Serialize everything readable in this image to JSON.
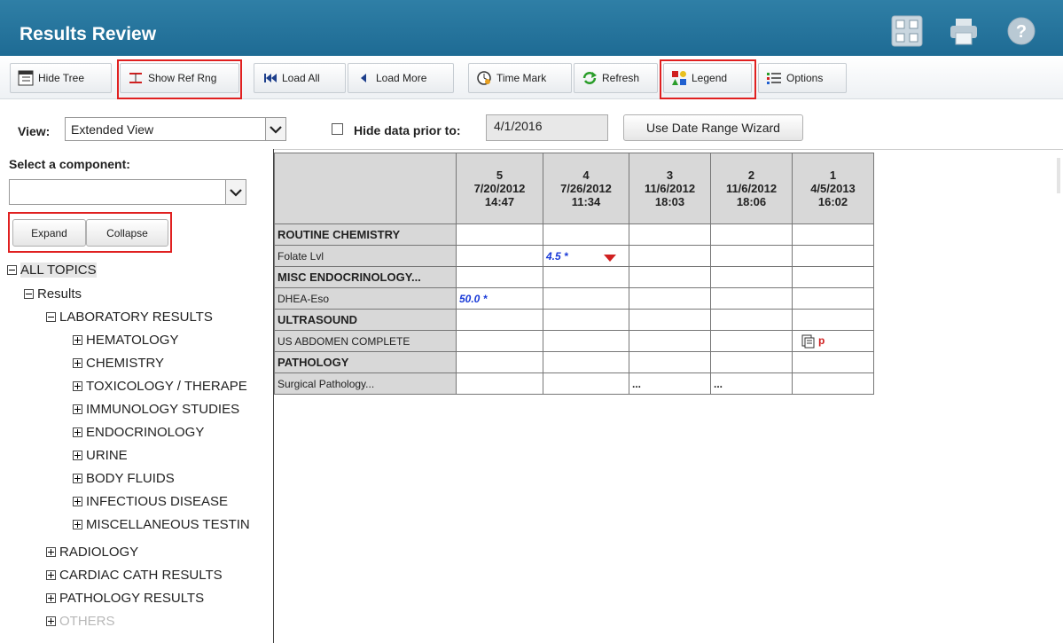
{
  "header": {
    "title": "Results Review",
    "icons": [
      "expand-icon",
      "print-icon",
      "help-icon"
    ]
  },
  "toolbar": {
    "hide_tree": "Hide Tree",
    "show_ref_rng": "Show Ref Rng",
    "load_all": "Load All",
    "load_more": "Load More",
    "time_mark": "Time Mark",
    "refresh": "Refresh",
    "legend": "Legend",
    "options": "Options"
  },
  "view": {
    "label": "View:",
    "selected": "Extended View",
    "hide_prior_label": "Hide data prior to:",
    "hide_prior_date": "4/1/2016",
    "date_wizard": "Use Date Range Wizard"
  },
  "left": {
    "select_label": "Select a component:",
    "select_value": "",
    "expand": "Expand",
    "collapse": "Collapse",
    "tree": [
      {
        "label": "ALL TOPICS",
        "level": 0,
        "expanded": true
      },
      {
        "label": "Results",
        "level": 1,
        "expanded": true
      },
      {
        "label": "LABORATORY RESULTS",
        "level": 2,
        "expanded": true
      },
      {
        "label": "HEMATOLOGY",
        "level": 3,
        "expanded": false
      },
      {
        "label": "CHEMISTRY",
        "level": 3,
        "expanded": false
      },
      {
        "label": "TOXICOLOGY / THERAPE",
        "level": 3,
        "expanded": false
      },
      {
        "label": "IMMUNOLOGY STUDIES",
        "level": 3,
        "expanded": false
      },
      {
        "label": "ENDOCRINOLOGY",
        "level": 3,
        "expanded": false
      },
      {
        "label": "URINE",
        "level": 3,
        "expanded": false
      },
      {
        "label": "BODY FLUIDS",
        "level": 3,
        "expanded": false
      },
      {
        "label": "INFECTIOUS DISEASE",
        "level": 3,
        "expanded": false
      },
      {
        "label": "MISCELLANEOUS TESTIN",
        "level": 3,
        "expanded": false
      },
      {
        "label": "RADIOLOGY",
        "level": 2,
        "expanded": false
      },
      {
        "label": "CARDIAC CATH RESULTS",
        "level": 2,
        "expanded": false
      },
      {
        "label": "PATHOLOGY RESULTS",
        "level": 2,
        "expanded": false
      },
      {
        "label": "OTHERS",
        "level": 2,
        "expanded": false,
        "greyed": true
      }
    ]
  },
  "grid": {
    "columns": [
      {
        "num": "5",
        "date": "7/20/2012",
        "time": "14:47"
      },
      {
        "num": "4",
        "date": "7/26/2012",
        "time": "11:34"
      },
      {
        "num": "3",
        "date": "11/6/2012",
        "time": "18:03"
      },
      {
        "num": "2",
        "date": "11/6/2012",
        "time": "18:06"
      },
      {
        "num": "1",
        "date": "4/5/2013",
        "time": "16:02"
      }
    ],
    "rows": [
      {
        "label": "ROUTINE CHEMISTRY",
        "section": true,
        "cells": [
          "",
          "",
          "",
          "",
          ""
        ]
      },
      {
        "label": "Folate Lvl",
        "section": false,
        "cells": [
          "",
          "4.5 *",
          "",
          "",
          ""
        ]
      },
      {
        "label": "MISC ENDOCRINOLOGY...",
        "section": true,
        "cells": [
          "",
          "",
          "",
          "",
          ""
        ]
      },
      {
        "label": "DHEA-Eso",
        "section": false,
        "cells": [
          "50.0 *",
          "",
          "",
          "",
          ""
        ]
      },
      {
        "label": "ULTRASOUND",
        "section": true,
        "cells": [
          "",
          "",
          "",
          "",
          ""
        ]
      },
      {
        "label": "US ABDOMEN COMPLETE",
        "section": false,
        "cells": [
          "",
          "",
          "",
          "",
          "p"
        ]
      },
      {
        "label": "PATHOLOGY",
        "section": true,
        "cells": [
          "",
          "",
          "",
          "",
          ""
        ]
      },
      {
        "label": "Surgical Pathology...",
        "section": false,
        "cells": [
          "",
          "",
          "...",
          "...",
          ""
        ]
      }
    ],
    "colors": {
      "value": "#1a3bd8",
      "flag_low": "#d02020",
      "doc_flag": "#d02020"
    }
  }
}
